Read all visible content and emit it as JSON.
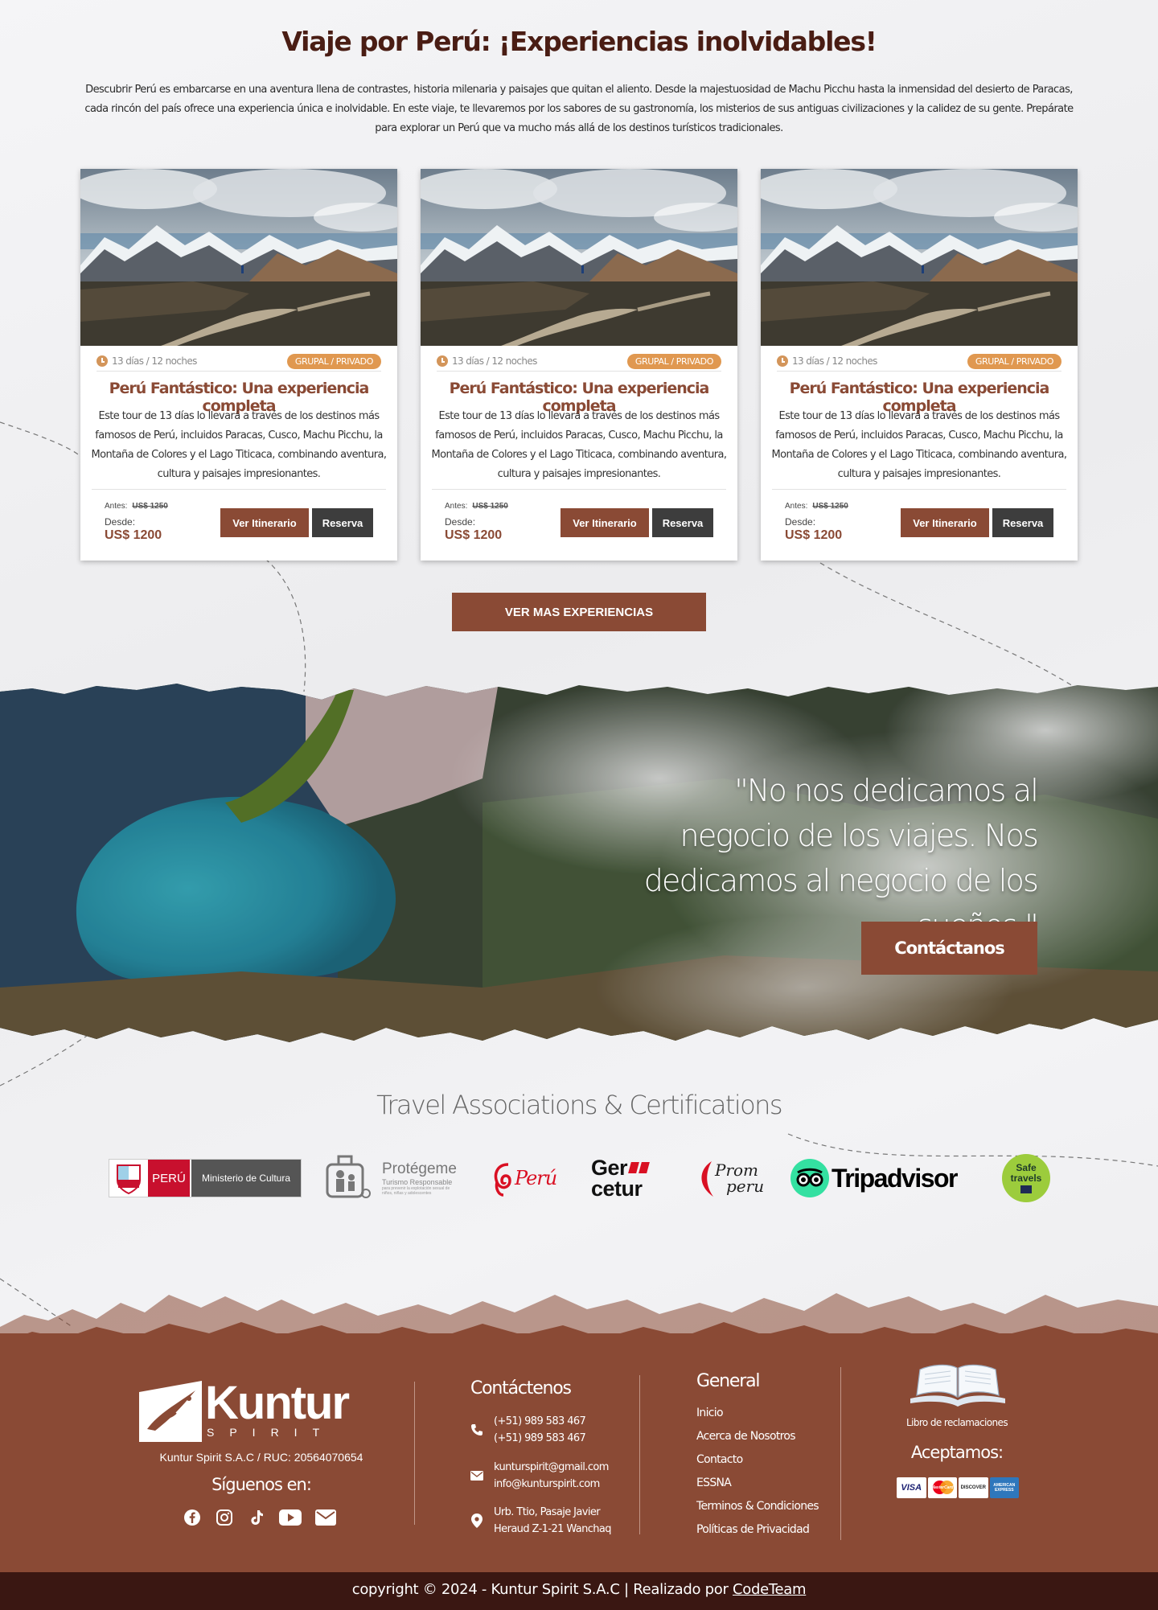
{
  "intro": {
    "title": "Viaje por Perú: ¡Experiencias inolvidables!",
    "text": "Descubrir Perú es embarcarse en una aventura llena de contrastes, historia milenaria y paisajes que quitan el aliento. Desde la majestuosidad de Machu Picchu hasta la inmensidad del desierto de Paracas, cada rincón del país ofrece una experiencia única e inolvidable. En este viaje, te llevaremos por los sabores de su gastronomía, los misterios de sus antiguas civilizaciones y la calidez de su gente. Prepárate para explorar un Perú que va mucho más allá de los destinos turísticos tradicionales."
  },
  "tours": [
    {
      "duration": "13 días / 12 noches",
      "badge": "GRUPAL / PRIVADO",
      "title": "Perú Fantástico: Una experiencia completa",
      "description": "Este tour de 13 días lo llevará a través de los destinos más famosos de Perú, incluidos Paracas, Cusco, Machu Picchu, la Montaña de Colores y el Lago Titicaca, combinando aventura, cultura y paisajes impresionantes.",
      "before_label": "Antes:",
      "before_price": "US$ 1250",
      "from_label": "Desde:",
      "price": "US$ 1200",
      "itinerary_label": "Ver Itinerario",
      "reserve_label": "Reserva"
    },
    {
      "duration": "13 días / 12 noches",
      "badge": "GRUPAL / PRIVADO",
      "title": "Perú Fantástico: Una experiencia completa",
      "description": "Este tour de 13 días lo llevará a través de los destinos más famosos de Perú, incluidos Paracas, Cusco, Machu Picchu, la Montaña de Colores y el Lago Titicaca, combinando aventura, cultura y paisajes impresionantes.",
      "before_label": "Antes:",
      "before_price": "US$ 1250",
      "from_label": "Desde:",
      "price": "US$ 1200",
      "itinerary_label": "Ver Itinerario",
      "reserve_label": "Reserva"
    },
    {
      "duration": "13 días / 12 noches",
      "badge": "GRUPAL / PRIVADO",
      "title": "Perú Fantástico: Una experiencia completa",
      "description": "Este tour de 13 días lo llevará a través de los destinos más famosos de Perú, incluidos Paracas, Cusco, Machu Picchu, la Montaña de Colores y el Lago Titicaca, combinando aventura, cultura y paisajes impresionantes.",
      "before_label": "Antes:",
      "before_price": "US$ 1250",
      "from_label": "Desde:",
      "price": "US$ 1200",
      "itinerary_label": "Ver Itinerario",
      "reserve_label": "Reserva"
    }
  ],
  "more_button": "VER MAS EXPERIENCIAS",
  "banner": {
    "quote": "\"No nos dedicamos al negocio de los viajes. Nos dedicamos al negocio de los sueños.\"",
    "contact_button": "Contáctanos"
  },
  "certifications": {
    "title": "Travel Associations & Certifications",
    "logos": [
      {
        "name": "peru-ministerio-cultura-logo",
        "text_a": "PERÚ",
        "text_b": "Ministerio de Cultura"
      },
      {
        "name": "protegeme-logo",
        "text_a": "Protégeme",
        "text_b": "Turismo Responsable",
        "text_c": "para prevenir la explotación sexual de niños, niñas y adolescentes"
      },
      {
        "name": "marca-peru-logo",
        "text_a": "Perú"
      },
      {
        "name": "gercetur-logo",
        "text_a": "Ger",
        "text_b": "cetur"
      },
      {
        "name": "promperu-logo",
        "text_a": "Prom",
        "text_b": "peru"
      },
      {
        "name": "tripadvisor-logo",
        "text_a": "Tripadvisor"
      },
      {
        "name": "safe-travels-logo",
        "text_a": "Safe",
        "text_b": "travels"
      }
    ]
  },
  "footer": {
    "brand_name": "Kuntur",
    "brand_sub": "SPIRIT",
    "ruc": "Kuntur Spirit S.A.C / RUC: 20564070654",
    "follow_label": "Síguenos en:",
    "socials": [
      "facebook-icon",
      "instagram-icon",
      "tiktok-icon",
      "youtube-icon",
      "mail-icon"
    ],
    "contact_title": "Contáctenos",
    "phone_1": "(+51) 989 583 467",
    "phone_2": "(+51) 989 583 467",
    "email_1": "kunturspirit@gmail.com",
    "email_2": "info@kunturspirit.com",
    "address_1": "Urb. Ttio, Pasaje Javier",
    "address_2": "Heraud Z-1-21 Wanchaq",
    "general_title": "General",
    "links": [
      "Inicio",
      "Acerca de Nosotros",
      "Contacto",
      "ESSNA",
      "Terminos & Condiciones",
      "Políticas de Privacidad"
    ],
    "claims_label": "Libro de reclamaciones",
    "accept_label": "Aceptamos:",
    "payment_methods": [
      "VISA",
      "MasterCard",
      "DISCOVER",
      "AMERICAN EXPRESS"
    ],
    "copyright": "copyright © 2024 - Kuntur Spirit S.A.C  |  Realizado por ",
    "credit_link": "CodeTeam"
  },
  "colors": {
    "brand_brown": "#8a4a35",
    "dark_button": "#3d3d3d",
    "badge_orange": "#e09850",
    "title_dark": "#4a1d14",
    "footer_bottom": "#3a1712"
  }
}
